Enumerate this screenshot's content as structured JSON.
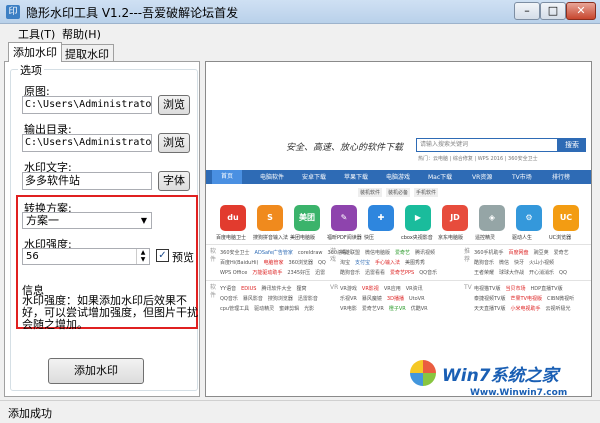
{
  "window": {
    "title": "隐形水印工具 V1.2---吾爱破解论坛首发",
    "min_symbol": "–",
    "max_symbol": "□",
    "close_symbol": "✕",
    "icon_glyph": "印"
  },
  "menu": {
    "items": [
      "工具(T)",
      "帮助(H)"
    ]
  },
  "tabs": [
    "添加水印",
    "提取水印"
  ],
  "options": {
    "group_title": "选项",
    "source_label": "原图:",
    "source_value": "C:\\Users\\Administrator\\Desk",
    "browse_label": "浏览",
    "output_label": "输出目录:",
    "output_value": "C:\\Users\\Administrator\\Desk",
    "watermark_text_label": "水印文字:",
    "watermark_text_value": "多多软件站",
    "font_button": "字体",
    "scheme_label": "转换方案:",
    "scheme_value": "方案一",
    "strength_label": "水印强度:",
    "strength_value": "56",
    "preview_label": "预览",
    "preview_checked": true,
    "info_title": "信息",
    "info_text": "水印强度：如果添加水印后效果不好，可以尝试增加强度，但图片干扰会随之增加。",
    "add_button": "添加水印"
  },
  "status": {
    "text": "添加成功"
  },
  "preview_page": {
    "slogan": "安全、高速、放心的软件下载",
    "search_placeholder": "请输入搜索关键词",
    "search_button": "搜索",
    "hot_words": "热门：云电脑 | 综合修复 | WPS 2016 | 360安全卫士",
    "nav": [
      "首页",
      "电脑软件",
      "安卓下载",
      "苹果下载",
      "电脑游戏",
      "Mac下载",
      "VR资源",
      "TV市场",
      "排行榜"
    ],
    "subtabs": [
      "装机软件",
      "装机必备",
      "手机软件"
    ],
    "icons": [
      {
        "glyph": "du",
        "color": "#e23b2e",
        "label": "百度电脑卫士"
      },
      {
        "glyph": "S",
        "color": "#f08a1d",
        "label": "搜狗拼音输入法"
      },
      {
        "glyph": "美团",
        "color": "#3bb36b",
        "label": "美团电脑版"
      },
      {
        "glyph": "✎",
        "color": "#8e44ad",
        "label": "福昕PDF阅读器"
      },
      {
        "glyph": "✚",
        "color": "#2e86de",
        "label": "快压"
      },
      {
        "glyph": "▶",
        "color": "#1abc9c",
        "label": "cbox央视影音"
      },
      {
        "glyph": "JD",
        "color": "#e74c3c",
        "label": "京东电脑版"
      },
      {
        "glyph": "◈",
        "color": "#95a5a6",
        "label": "遥控精灵"
      },
      {
        "glyph": "⚙",
        "color": "#3498db",
        "label": "驱动人生"
      },
      {
        "glyph": "UC",
        "color": "#f39c12",
        "label": "UC浏览器"
      }
    ],
    "block1": {
      "cat": "软件",
      "rows": [
        [
          "360安全卫士",
          "ADSafe广告管家",
          "coreldraw",
          "360杀毒"
        ],
        [
          "百度Hi(BaiduHi)",
          "电脑管家",
          "360浏览器",
          "QQ"
        ],
        [
          "WPS Office",
          "万能驱动助手",
          "2345好压",
          "迅雷"
        ]
      ]
    },
    "block2": {
      "cat": "游戏",
      "rows": [
        [
          "英雄联盟",
          "微信电脑版",
          "爱奇艺",
          "腾讯视频"
        ],
        [
          "淘宝",
          "支付宝",
          "手心输入法",
          "美图秀秀"
        ],
        [
          "酷狗音乐",
          "迅雷看看",
          "爱奇艺PPS",
          "QQ音乐"
        ]
      ]
    },
    "block3": {
      "cat": "推荐",
      "rows": [
        [
          "360手机助手",
          "百度网盘",
          "豌豆荚",
          "爱奇艺"
        ],
        [
          "酷狗音乐",
          "微信",
          "快牙",
          "火山小视频"
        ],
        [
          "王者荣耀",
          "球球大作战",
          "开心消消乐",
          "QQ"
        ]
      ]
    },
    "block4": {
      "cat": "软件",
      "rows": [
        [
          "YY语音",
          "EDIUS",
          "腾讯软件大全",
          "狸窝"
        ],
        [
          "QQ音乐",
          "暴风影音",
          "搜狗浏览器",
          "迅雷影音"
        ],
        [
          "cpu管理工具",
          "驱动精灵",
          "蜜蜂剪辑",
          "光影"
        ]
      ]
    },
    "block5": {
      "cat": "VR",
      "rows": [
        [
          "VR游戏",
          "VR影视",
          "VR应用",
          "VR资讯"
        ],
        [
          "乐视VR",
          "暴风魔镜",
          "3D播播",
          "UtoVR"
        ],
        [
          "VR电影",
          "爱奇艺VR",
          "橙子VR",
          "优酷VR"
        ]
      ]
    },
    "block6": {
      "cat": "TV",
      "rows": [
        [
          "电视猫TV版",
          "当贝市场",
          "HDP直播TV版"
        ],
        [
          "泰捷视频TV版",
          "芒果TV电视版",
          "CIBN微视听"
        ],
        [
          "天天直播TV版",
          "小米电视助手",
          "云视听极光"
        ]
      ]
    },
    "watermark_brand": "Win7系统之家",
    "watermark_url": "Www.Winwin7.com"
  }
}
